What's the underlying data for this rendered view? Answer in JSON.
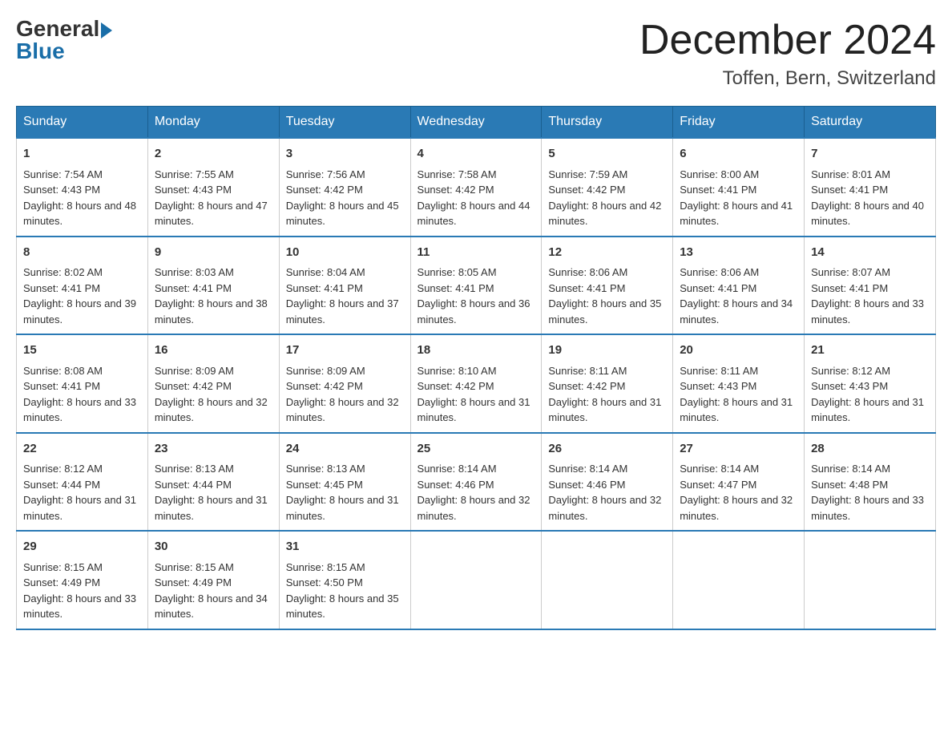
{
  "logo": {
    "general": "General",
    "blue": "Blue"
  },
  "header": {
    "month_title": "December 2024",
    "location": "Toffen, Bern, Switzerland"
  },
  "days_of_week": [
    "Sunday",
    "Monday",
    "Tuesday",
    "Wednesday",
    "Thursday",
    "Friday",
    "Saturday"
  ],
  "weeks": [
    [
      {
        "day": "1",
        "sunrise": "Sunrise: 7:54 AM",
        "sunset": "Sunset: 4:43 PM",
        "daylight": "Daylight: 8 hours and 48 minutes."
      },
      {
        "day": "2",
        "sunrise": "Sunrise: 7:55 AM",
        "sunset": "Sunset: 4:43 PM",
        "daylight": "Daylight: 8 hours and 47 minutes."
      },
      {
        "day": "3",
        "sunrise": "Sunrise: 7:56 AM",
        "sunset": "Sunset: 4:42 PM",
        "daylight": "Daylight: 8 hours and 45 minutes."
      },
      {
        "day": "4",
        "sunrise": "Sunrise: 7:58 AM",
        "sunset": "Sunset: 4:42 PM",
        "daylight": "Daylight: 8 hours and 44 minutes."
      },
      {
        "day": "5",
        "sunrise": "Sunrise: 7:59 AM",
        "sunset": "Sunset: 4:42 PM",
        "daylight": "Daylight: 8 hours and 42 minutes."
      },
      {
        "day": "6",
        "sunrise": "Sunrise: 8:00 AM",
        "sunset": "Sunset: 4:41 PM",
        "daylight": "Daylight: 8 hours and 41 minutes."
      },
      {
        "day": "7",
        "sunrise": "Sunrise: 8:01 AM",
        "sunset": "Sunset: 4:41 PM",
        "daylight": "Daylight: 8 hours and 40 minutes."
      }
    ],
    [
      {
        "day": "8",
        "sunrise": "Sunrise: 8:02 AM",
        "sunset": "Sunset: 4:41 PM",
        "daylight": "Daylight: 8 hours and 39 minutes."
      },
      {
        "day": "9",
        "sunrise": "Sunrise: 8:03 AM",
        "sunset": "Sunset: 4:41 PM",
        "daylight": "Daylight: 8 hours and 38 minutes."
      },
      {
        "day": "10",
        "sunrise": "Sunrise: 8:04 AM",
        "sunset": "Sunset: 4:41 PM",
        "daylight": "Daylight: 8 hours and 37 minutes."
      },
      {
        "day": "11",
        "sunrise": "Sunrise: 8:05 AM",
        "sunset": "Sunset: 4:41 PM",
        "daylight": "Daylight: 8 hours and 36 minutes."
      },
      {
        "day": "12",
        "sunrise": "Sunrise: 8:06 AM",
        "sunset": "Sunset: 4:41 PM",
        "daylight": "Daylight: 8 hours and 35 minutes."
      },
      {
        "day": "13",
        "sunrise": "Sunrise: 8:06 AM",
        "sunset": "Sunset: 4:41 PM",
        "daylight": "Daylight: 8 hours and 34 minutes."
      },
      {
        "day": "14",
        "sunrise": "Sunrise: 8:07 AM",
        "sunset": "Sunset: 4:41 PM",
        "daylight": "Daylight: 8 hours and 33 minutes."
      }
    ],
    [
      {
        "day": "15",
        "sunrise": "Sunrise: 8:08 AM",
        "sunset": "Sunset: 4:41 PM",
        "daylight": "Daylight: 8 hours and 33 minutes."
      },
      {
        "day": "16",
        "sunrise": "Sunrise: 8:09 AM",
        "sunset": "Sunset: 4:42 PM",
        "daylight": "Daylight: 8 hours and 32 minutes."
      },
      {
        "day": "17",
        "sunrise": "Sunrise: 8:09 AM",
        "sunset": "Sunset: 4:42 PM",
        "daylight": "Daylight: 8 hours and 32 minutes."
      },
      {
        "day": "18",
        "sunrise": "Sunrise: 8:10 AM",
        "sunset": "Sunset: 4:42 PM",
        "daylight": "Daylight: 8 hours and 31 minutes."
      },
      {
        "day": "19",
        "sunrise": "Sunrise: 8:11 AM",
        "sunset": "Sunset: 4:42 PM",
        "daylight": "Daylight: 8 hours and 31 minutes."
      },
      {
        "day": "20",
        "sunrise": "Sunrise: 8:11 AM",
        "sunset": "Sunset: 4:43 PM",
        "daylight": "Daylight: 8 hours and 31 minutes."
      },
      {
        "day": "21",
        "sunrise": "Sunrise: 8:12 AM",
        "sunset": "Sunset: 4:43 PM",
        "daylight": "Daylight: 8 hours and 31 minutes."
      }
    ],
    [
      {
        "day": "22",
        "sunrise": "Sunrise: 8:12 AM",
        "sunset": "Sunset: 4:44 PM",
        "daylight": "Daylight: 8 hours and 31 minutes."
      },
      {
        "day": "23",
        "sunrise": "Sunrise: 8:13 AM",
        "sunset": "Sunset: 4:44 PM",
        "daylight": "Daylight: 8 hours and 31 minutes."
      },
      {
        "day": "24",
        "sunrise": "Sunrise: 8:13 AM",
        "sunset": "Sunset: 4:45 PM",
        "daylight": "Daylight: 8 hours and 31 minutes."
      },
      {
        "day": "25",
        "sunrise": "Sunrise: 8:14 AM",
        "sunset": "Sunset: 4:46 PM",
        "daylight": "Daylight: 8 hours and 32 minutes."
      },
      {
        "day": "26",
        "sunrise": "Sunrise: 8:14 AM",
        "sunset": "Sunset: 4:46 PM",
        "daylight": "Daylight: 8 hours and 32 minutes."
      },
      {
        "day": "27",
        "sunrise": "Sunrise: 8:14 AM",
        "sunset": "Sunset: 4:47 PM",
        "daylight": "Daylight: 8 hours and 32 minutes."
      },
      {
        "day": "28",
        "sunrise": "Sunrise: 8:14 AM",
        "sunset": "Sunset: 4:48 PM",
        "daylight": "Daylight: 8 hours and 33 minutes."
      }
    ],
    [
      {
        "day": "29",
        "sunrise": "Sunrise: 8:15 AM",
        "sunset": "Sunset: 4:49 PM",
        "daylight": "Daylight: 8 hours and 33 minutes."
      },
      {
        "day": "30",
        "sunrise": "Sunrise: 8:15 AM",
        "sunset": "Sunset: 4:49 PM",
        "daylight": "Daylight: 8 hours and 34 minutes."
      },
      {
        "day": "31",
        "sunrise": "Sunrise: 8:15 AM",
        "sunset": "Sunset: 4:50 PM",
        "daylight": "Daylight: 8 hours and 35 minutes."
      },
      null,
      null,
      null,
      null
    ]
  ]
}
